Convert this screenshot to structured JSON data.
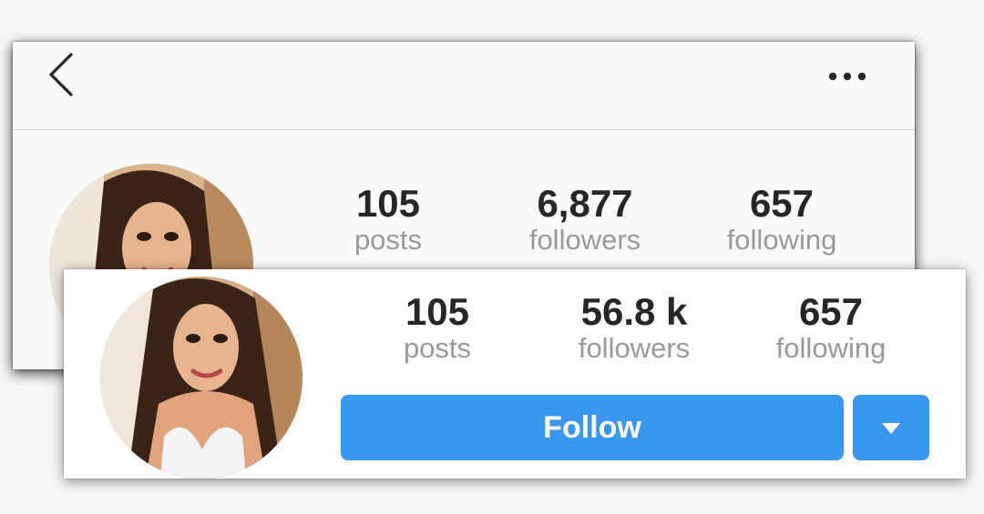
{
  "original_profile": {
    "header": {
      "back_icon": "chevron-left-icon",
      "more_icon": "more-horizontal-icon"
    },
    "stats": [
      {
        "value": "105",
        "label": "posts"
      },
      {
        "value": "6,877",
        "label": "followers"
      },
      {
        "value": "657",
        "label": "following"
      }
    ]
  },
  "boosted_profile": {
    "stats": [
      {
        "value": "105",
        "label": "posts"
      },
      {
        "value": "56.8 k",
        "label": "followers"
      },
      {
        "value": "657",
        "label": "following"
      }
    ],
    "follow_label": "Follow",
    "dropdown_icon": "caret-down-icon"
  },
  "colors": {
    "accent": "#3897f0",
    "stat_value": "#262626",
    "stat_label": "#999999",
    "background": "#fafafa"
  }
}
